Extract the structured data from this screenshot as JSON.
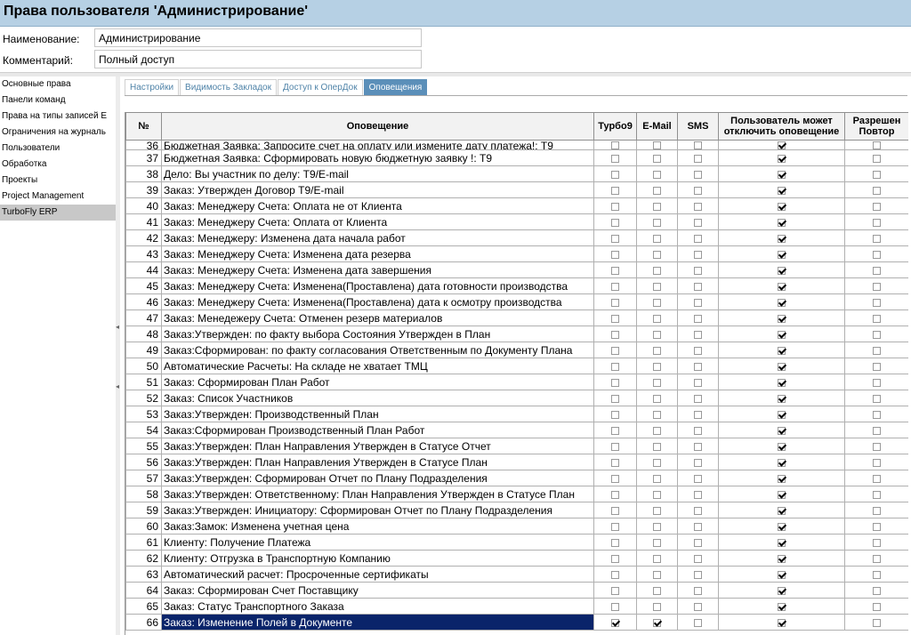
{
  "window": {
    "title": "Права пользователя 'Администрирование'"
  },
  "form": {
    "name_label": "Наименование:",
    "name_value": "Администрирование",
    "comment_label": "Комментарий:",
    "comment_value": "Полный доступ"
  },
  "nav": {
    "items": [
      {
        "label": "Основные права",
        "active": false
      },
      {
        "label": "Панели команд",
        "active": false
      },
      {
        "label": "Права на типы записей E",
        "active": false
      },
      {
        "label": "Ограничения на журналь",
        "active": false
      },
      {
        "label": "Пользователи",
        "active": false
      },
      {
        "label": "Обработка",
        "active": false
      },
      {
        "label": "Проекты",
        "active": false
      },
      {
        "label": "Project Management",
        "active": false
      },
      {
        "label": "TurboFly ERP",
        "active": true
      }
    ]
  },
  "tabs": [
    {
      "label": "Настройки",
      "active": false
    },
    {
      "label": "Видимость Закладок",
      "active": false
    },
    {
      "label": "Доступ к ОперДок",
      "active": false
    },
    {
      "label": "Оповещения",
      "active": true
    }
  ],
  "grid": {
    "headers": {
      "num": "№",
      "notification": "Оповещение",
      "turbo": "Турбо9",
      "email": "E-Mail",
      "sms": "SMS",
      "user_can_disable": "Пользователь может отключить оповещение",
      "repeat_allowed": "Разрешен Повтор"
    },
    "rows": [
      {
        "num": "36",
        "text": "Бюджетная Заявка: Запросите счет на оплату или измените дату платежа!: Т9",
        "turbo": false,
        "email": false,
        "sms": false,
        "disable": true,
        "repeat": false,
        "cut": true
      },
      {
        "num": "37",
        "text": "Бюджетная Заявка:  Сформировать новую бюджетную заявку !: Т9",
        "turbo": false,
        "email": false,
        "sms": false,
        "disable": true,
        "repeat": false
      },
      {
        "num": "38",
        "text": "Дело:  Вы участник по делу: Т9/E-mail",
        "turbo": false,
        "email": false,
        "sms": false,
        "disable": true,
        "repeat": false
      },
      {
        "num": "39",
        "text": "Заказ: Утвержден Договор Т9/E-mail",
        "turbo": false,
        "email": false,
        "sms": false,
        "disable": true,
        "repeat": false
      },
      {
        "num": "40",
        "text": "Заказ: Менеджеру Счета: Оплата не от Клиента",
        "turbo": false,
        "email": false,
        "sms": false,
        "disable": true,
        "repeat": false
      },
      {
        "num": "41",
        "text": "Заказ: Менеджеру Счета: Оплата от Клиента",
        "turbo": false,
        "email": false,
        "sms": false,
        "disable": true,
        "repeat": false
      },
      {
        "num": "42",
        "text": "Заказ: Менеджеру: Изменена дата начала работ",
        "turbo": false,
        "email": false,
        "sms": false,
        "disable": true,
        "repeat": false
      },
      {
        "num": "43",
        "text": "Заказ: Менеджеру Счета: Изменена дата резерва",
        "turbo": false,
        "email": false,
        "sms": false,
        "disable": true,
        "repeat": false
      },
      {
        "num": "44",
        "text": "Заказ: Менеджеру Счета: Изменена дата завершения",
        "turbo": false,
        "email": false,
        "sms": false,
        "disable": true,
        "repeat": false
      },
      {
        "num": "45",
        "text": "Заказ: Менеджеру Счета: Изменена(Проставлена) дата готовности производства",
        "turbo": false,
        "email": false,
        "sms": false,
        "disable": true,
        "repeat": false
      },
      {
        "num": "46",
        "text": "Заказ: Менеджеру Счета: Изменена(Проставлена) дата к осмотру производства",
        "turbo": false,
        "email": false,
        "sms": false,
        "disable": true,
        "repeat": false
      },
      {
        "num": "47",
        "text": "Заказ: Менедежеру Счета: Отменен резерв материалов",
        "turbo": false,
        "email": false,
        "sms": false,
        "disable": true,
        "repeat": false
      },
      {
        "num": "48",
        "text": "Заказ:Утвержден: по факту выбора Состояния Утвержден в План",
        "turbo": false,
        "email": false,
        "sms": false,
        "disable": true,
        "repeat": false
      },
      {
        "num": "49",
        "text": "Заказ:Сформирован: по факту согласования Ответственным по Документу Плана",
        "turbo": false,
        "email": false,
        "sms": false,
        "disable": true,
        "repeat": false
      },
      {
        "num": "50",
        "text": "Автоматические Расчеты: На складе не хватает ТМЦ",
        "turbo": false,
        "email": false,
        "sms": false,
        "disable": true,
        "repeat": false
      },
      {
        "num": "51",
        "text": "Заказ: Сформирован План Работ",
        "turbo": false,
        "email": false,
        "sms": false,
        "disable": true,
        "repeat": false
      },
      {
        "num": "52",
        "text": "Заказ: Список Участников",
        "turbo": false,
        "email": false,
        "sms": false,
        "disable": true,
        "repeat": false
      },
      {
        "num": "53",
        "text": "Заказ:Утвержден: Производственный План",
        "turbo": false,
        "email": false,
        "sms": false,
        "disable": true,
        "repeat": false
      },
      {
        "num": "54",
        "text": "Заказ:Сформирован Производственный План Работ",
        "turbo": false,
        "email": false,
        "sms": false,
        "disable": true,
        "repeat": false
      },
      {
        "num": "55",
        "text": "Заказ:Утвержден: План Направления Утвержден в Статусе Отчет",
        "turbo": false,
        "email": false,
        "sms": false,
        "disable": true,
        "repeat": false
      },
      {
        "num": "56",
        "text": "Заказ:Утвержден: План Направления Утвержден в Статусе План",
        "turbo": false,
        "email": false,
        "sms": false,
        "disable": true,
        "repeat": false
      },
      {
        "num": "57",
        "text": "Заказ:Утвержден: Сформирован Отчет по Плану Подразделения",
        "turbo": false,
        "email": false,
        "sms": false,
        "disable": true,
        "repeat": false
      },
      {
        "num": "58",
        "text": "Заказ:Утвержден: Ответственному: План Направления Утвержден в Статусе План",
        "turbo": false,
        "email": false,
        "sms": false,
        "disable": true,
        "repeat": false
      },
      {
        "num": "59",
        "text": "Заказ:Утвержден: Инициатору: Сформирован Отчет по Плану Подразделения",
        "turbo": false,
        "email": false,
        "sms": false,
        "disable": true,
        "repeat": false
      },
      {
        "num": "60",
        "text": "Заказ:Замок: Изменена учетная цена",
        "turbo": false,
        "email": false,
        "sms": false,
        "disable": true,
        "repeat": false
      },
      {
        "num": "61",
        "text": "Клиенту: Получение Платежа",
        "turbo": false,
        "email": false,
        "sms": false,
        "disable": true,
        "repeat": false
      },
      {
        "num": "62",
        "text": "Клиенту: Отгрузка в Транспортную Компанию",
        "turbo": false,
        "email": false,
        "sms": false,
        "disable": true,
        "repeat": false
      },
      {
        "num": "63",
        "text": "Автоматический расчет: Просроченные сертификаты",
        "turbo": false,
        "email": false,
        "sms": false,
        "disable": true,
        "repeat": false
      },
      {
        "num": "64",
        "text": "Заказ: Сформирован Счет Поставщику",
        "turbo": false,
        "email": false,
        "sms": false,
        "disable": true,
        "repeat": false
      },
      {
        "num": "65",
        "text": "Заказ: Статус Транспортного Заказа",
        "turbo": false,
        "email": false,
        "sms": false,
        "disable": true,
        "repeat": false
      },
      {
        "num": "66",
        "text": "Заказ: Изменение Полей в Документе",
        "turbo": true,
        "email": true,
        "sms": false,
        "disable": true,
        "repeat": false,
        "selected": true
      }
    ]
  }
}
